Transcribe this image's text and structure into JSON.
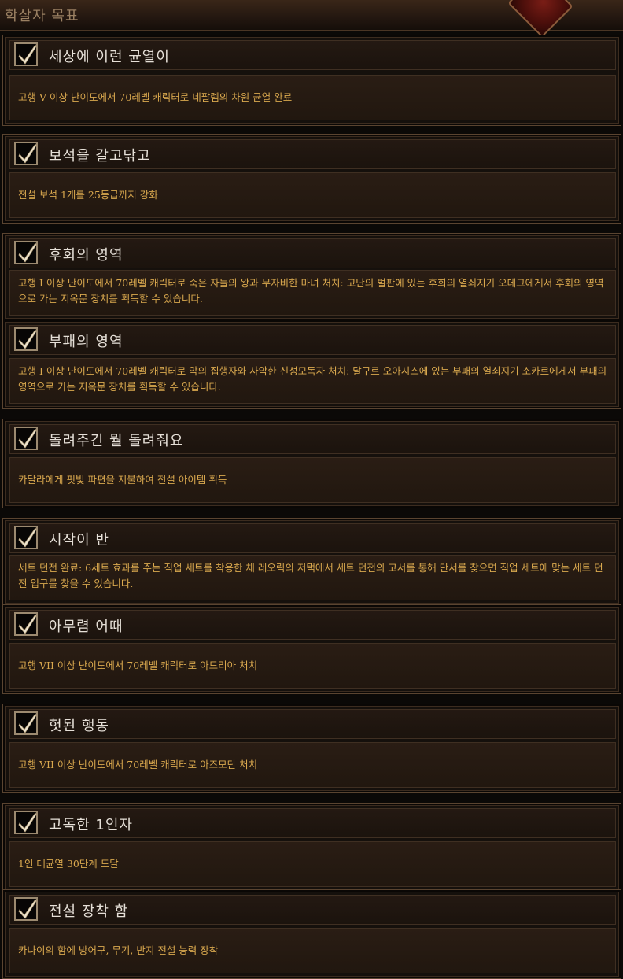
{
  "header": {
    "title": "학살자 목표"
  },
  "achievements": [
    {
      "title": "세상에 이런 균열이",
      "description": "고행 V 이상 난이도에서 70레벨 캐릭터로 네팔렘의 차원 균열 완료",
      "completed": true
    },
    {
      "title": "보석을 갈고닦고",
      "description": "전설 보석 1개를 25등급까지 강화",
      "completed": true
    },
    {
      "title": "후회의 영역",
      "description": "고행 I 이상 난이도에서 70레벨 캐릭터로 죽은 자들의 왕과 무자비한 마녀 처치: 고난의 벌판에 있는 후회의 열쇠지기 오데그에게서 후회의 영역으로 가는 지옥문 장치를 획득할 수 있습니다.",
      "completed": true
    },
    {
      "title": "부패의 영역",
      "description": "고행 I 이상 난이도에서 70레벨 캐릭터로 악의 집행자와 사악한 신성모독자 처치: 달구르 오아시스에 있는 부패의 열쇠지기 소카르에게서 부패의 영역으로 가는 지옥문 장치를 획득할 수 있습니다.",
      "completed": true
    },
    {
      "title": "돌려주긴 뭘 돌려줘요",
      "description": "카달라에게 핏빛 파편을 지불하여 전설 아이템 획득",
      "completed": true
    },
    {
      "title": "시작이 반",
      "description": "세트 던전 완료: 6세트 효과를 주는 직업 세트를 착용한 채 레오릭의 저택에서 세트 던전의 고서를 통해 단서를 찾으면 직업 세트에 맞는 세트 던전 입구를 찾을 수 있습니다.",
      "completed": true
    },
    {
      "title": "아무렴 어때",
      "description": "고행 VII 이상 난이도에서 70레벨 캐릭터로 아드리아 처치",
      "completed": true
    },
    {
      "title": "헛된 행동",
      "description": "고행 VII 이상 난이도에서 70레벨 캐릭터로 아즈모단 처치",
      "completed": true
    },
    {
      "title": "고독한 1인자",
      "description": "1인 대균열 30단계 도달",
      "completed": true
    },
    {
      "title": "전설 장착 함",
      "description": "카나이의 함에 방어구, 무기, 반지 전설 능력 장착",
      "completed": true
    }
  ],
  "icons": {
    "checkbox": "checkmark-icon",
    "emblem": "emblem-icon"
  },
  "colors": {
    "title": "#e6e0d8",
    "description": "#d9a84e",
    "header": "#9a8062",
    "checkmark": "#efe6d2"
  }
}
